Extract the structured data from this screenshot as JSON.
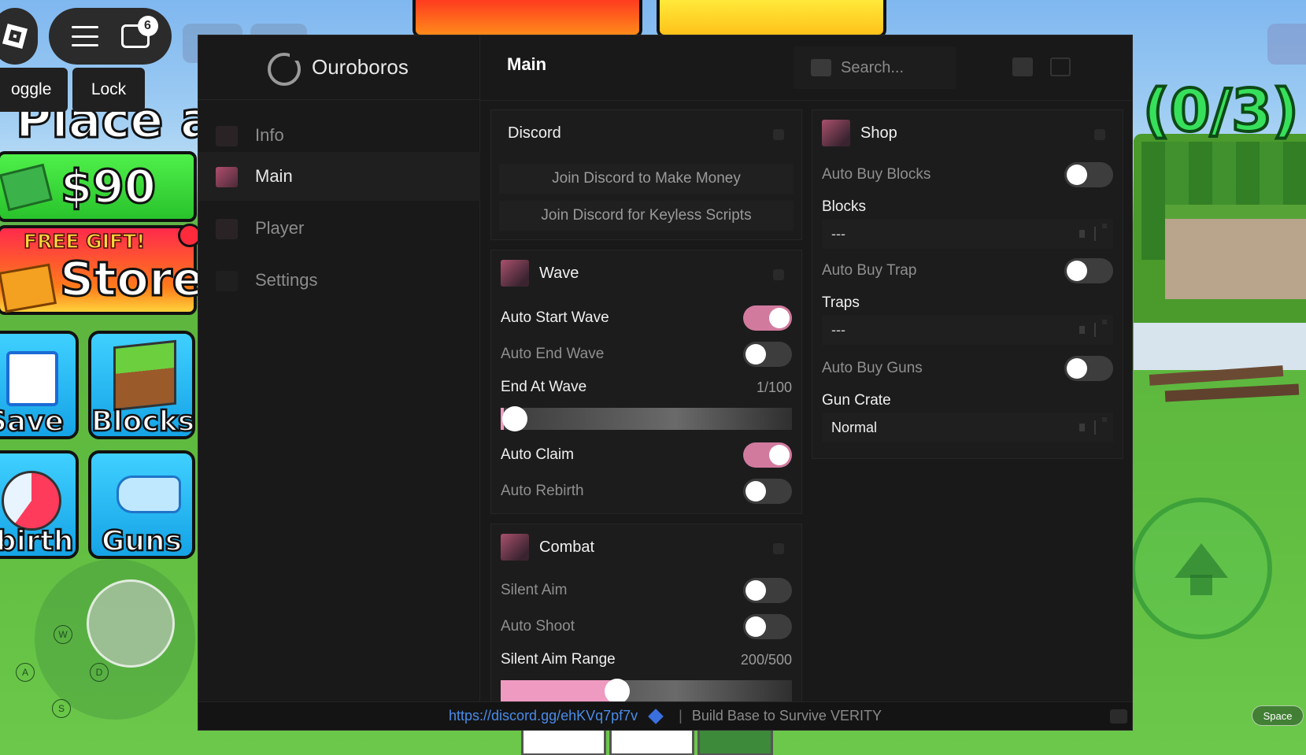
{
  "hud": {
    "chat_badge": "6",
    "toggle_label": "oggle",
    "lock_label": "Lock",
    "place_text": "Place a",
    "wave_count": "(0/3)",
    "money": "$90",
    "free_gift": "FREE GIFT!",
    "store_label": "Store",
    "tiles": {
      "save": "Save",
      "blocks": "Blocks",
      "rebirth": "ebirth",
      "guns": "Guns"
    },
    "keys": {
      "w": "W",
      "a": "A",
      "d": "D",
      "s": "S"
    },
    "space_label": "Space"
  },
  "window": {
    "brand": "Ouroboros",
    "header_title": "Main",
    "search_placeholder": "Search...",
    "nav": [
      {
        "label": "Info",
        "icon": "info-icon"
      },
      {
        "label": "Main",
        "icon": "main-icon",
        "active": true
      },
      {
        "label": "Player",
        "icon": "player-icon"
      },
      {
        "label": "Settings",
        "icon": "settings-icon"
      }
    ],
    "discord": {
      "title": "Discord",
      "buttons": [
        "Join Discord to Make Money",
        "Join Discord for Keyless Scripts"
      ]
    },
    "wave": {
      "title": "Wave",
      "auto_start_wave": {
        "label": "Auto Start Wave",
        "on": true
      },
      "auto_end_wave": {
        "label": "Auto End Wave",
        "on": false
      },
      "end_at_wave": {
        "label": "End At Wave",
        "value": "1/100",
        "fraction": 0.01
      },
      "auto_claim": {
        "label": "Auto Claim",
        "on": true
      },
      "auto_rebirth": {
        "label": "Auto Rebirth",
        "on": false
      }
    },
    "combat": {
      "title": "Combat",
      "silent_aim": {
        "label": "Silent Aim",
        "on": false
      },
      "auto_shoot": {
        "label": "Auto Shoot",
        "on": false
      },
      "silent_aim_range": {
        "label": "Silent Aim Range",
        "value": "200/500",
        "fraction": 0.4
      }
    },
    "shop": {
      "title": "Shop",
      "auto_buy_blocks": {
        "label": "Auto Buy Blocks",
        "on": false
      },
      "blocks": {
        "label": "Blocks",
        "value": "---"
      },
      "auto_buy_trap": {
        "label": "Auto Buy Trap",
        "on": false
      },
      "traps": {
        "label": "Traps",
        "value": "---"
      },
      "auto_buy_guns": {
        "label": "Auto Buy Guns",
        "on": false
      },
      "gun_crate": {
        "label": "Gun Crate",
        "value": "Normal"
      }
    },
    "footer": {
      "link": "https://discord.gg/ehKVq7pf7v",
      "separator": "|",
      "game_name": "Build Base to Survive VERITY"
    },
    "colors": {
      "accent": "#d27a9e",
      "slider_fill": "#ef9ac0",
      "link": "#4a8ce8",
      "panel_bg": "#191919"
    }
  }
}
